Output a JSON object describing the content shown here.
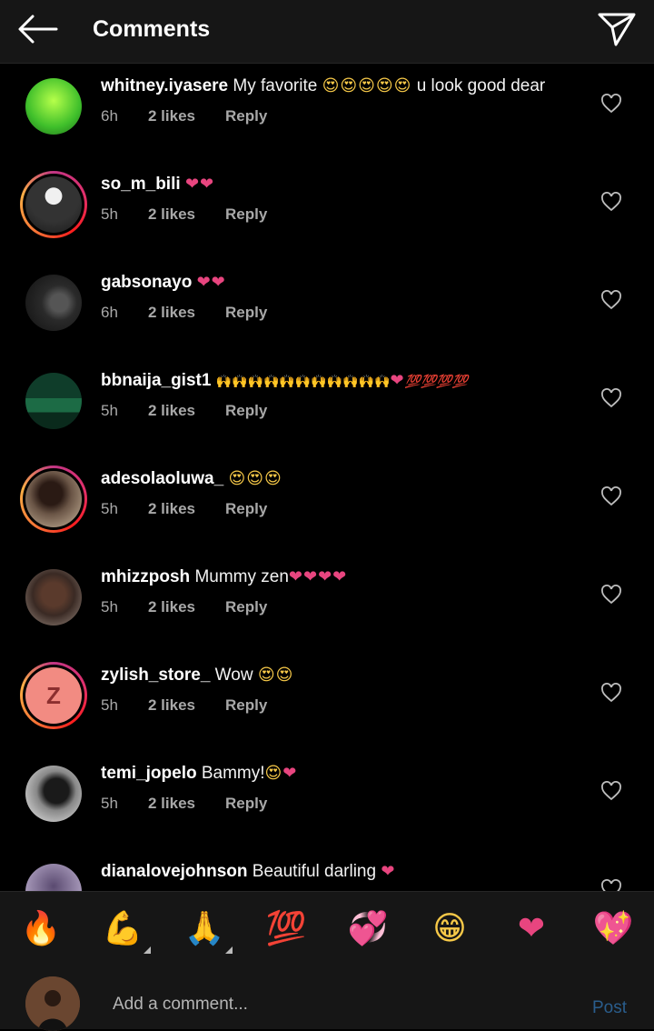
{
  "header": {
    "title": "Comments",
    "back_icon": "back-arrow-icon",
    "share_icon": "send-icon"
  },
  "comments": [
    {
      "username": "whitney.iyasere",
      "text_before": " My favorite ",
      "emoji": "😍😍😍😍😍",
      "text_after": " u look good dear",
      "time": "6h",
      "likes": "2 likes",
      "reply": "Reply",
      "avatar_color": "#5bd12a"
    },
    {
      "username": "so_m_bili",
      "text_before": " ",
      "emoji_hearts": "❤❤",
      "time": "5h",
      "likes": "2 likes",
      "reply": "Reply",
      "avatar_color": "#3a3a3a"
    },
    {
      "username": "gabsonayo",
      "text_before": " ",
      "emoji_hearts": "❤❤",
      "time": "6h",
      "likes": "2 likes",
      "reply": "Reply",
      "avatar_color": "#2a2a2a"
    },
    {
      "username": "bbnaija_gist1",
      "text_before": " ",
      "emoji": "🙌🙌🙌🙌🙌🙌🙌🙌🙌🙌🙌",
      "emoji_hearts": "❤",
      "emoji_100": "💯💯💯💯",
      "time": "5h",
      "likes": "2 likes",
      "reply": "Reply",
      "avatar_color": "#0f3d2a"
    },
    {
      "username": "adesolaoluwa_",
      "text_before": " ",
      "emoji": "😍😍😍",
      "time": "5h",
      "likes": "2 likes",
      "reply": "Reply",
      "avatar_color": "#4a3a30"
    },
    {
      "username": "mhizzposh",
      "text_before": " Mummy zen",
      "emoji_hearts": "❤❤❤❤",
      "time": "5h",
      "likes": "2 likes",
      "reply": "Reply",
      "avatar_color": "#6a4a3c"
    },
    {
      "username": "zylish_store_",
      "text_before": " Wow ",
      "emoji": "😍😍",
      "time": "5h",
      "likes": "2 likes",
      "reply": "Reply",
      "avatar_letter": "Z",
      "avatar_color": "#f28b82"
    },
    {
      "username": "temi_jopelo",
      "text_before": " Bammy!",
      "emoji": "😍",
      "emoji_hearts": "❤",
      "time": "5h",
      "likes": "2 likes",
      "reply": "Reply",
      "avatar_color": "#d8d8d8"
    },
    {
      "username": "dianalovejohnson",
      "text_before": " Beautiful darling ",
      "emoji_hearts": "❤",
      "avatar_color": "#7a6a90"
    }
  ],
  "emoji_bar": [
    "🔥",
    "💪",
    "🙏",
    "💯",
    "💞",
    "😁",
    "❤",
    "💖"
  ],
  "composer": {
    "placeholder": "Add a comment...",
    "post_label": "Post"
  }
}
